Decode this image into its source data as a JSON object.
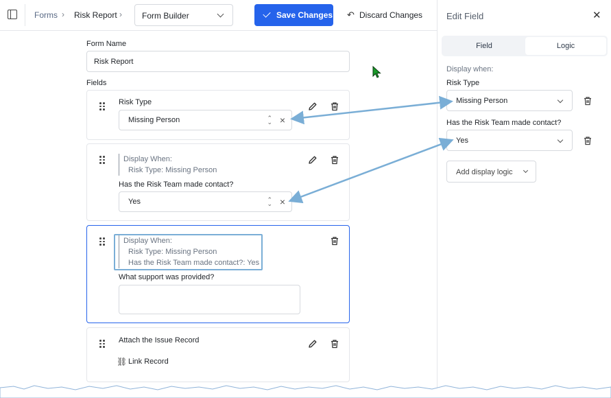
{
  "topbar": {
    "breadcrumb_forms": "Forms",
    "breadcrumb_current": "Risk Report",
    "builder_select": "Form Builder",
    "save_label": "Save Changes",
    "discard_label": "Discard Changes"
  },
  "form": {
    "name_label": "Form Name",
    "name_value": "Risk Report",
    "fields_label": "Fields",
    "fields": [
      {
        "label": "Risk Type",
        "value": "Missing Person"
      },
      {
        "cond_title": "Display When:",
        "cond1": "Risk Type: Missing Person",
        "label": "Has the Risk Team made contact?",
        "value": "Yes"
      },
      {
        "cond_title": "Display When:",
        "cond1": "Risk Type: Missing Person",
        "cond2": "Has the Risk Team made contact?: Yes",
        "label": "What support was provided?"
      },
      {
        "label": "Attach the Issue Record",
        "link_label": "Link Record"
      }
    ]
  },
  "panel": {
    "title": "Edit Field",
    "tab_field": "Field",
    "tab_logic": "Logic",
    "display_when": "Display when:",
    "rule1_label": "Risk Type",
    "rule1_value": "Missing Person",
    "rule2_label": "Has the Risk Team made contact?",
    "rule2_value": "Yes",
    "add_logic": "Add display logic"
  },
  "colors": {
    "accent": "#2563eb",
    "annotation": "#7aaed6"
  }
}
